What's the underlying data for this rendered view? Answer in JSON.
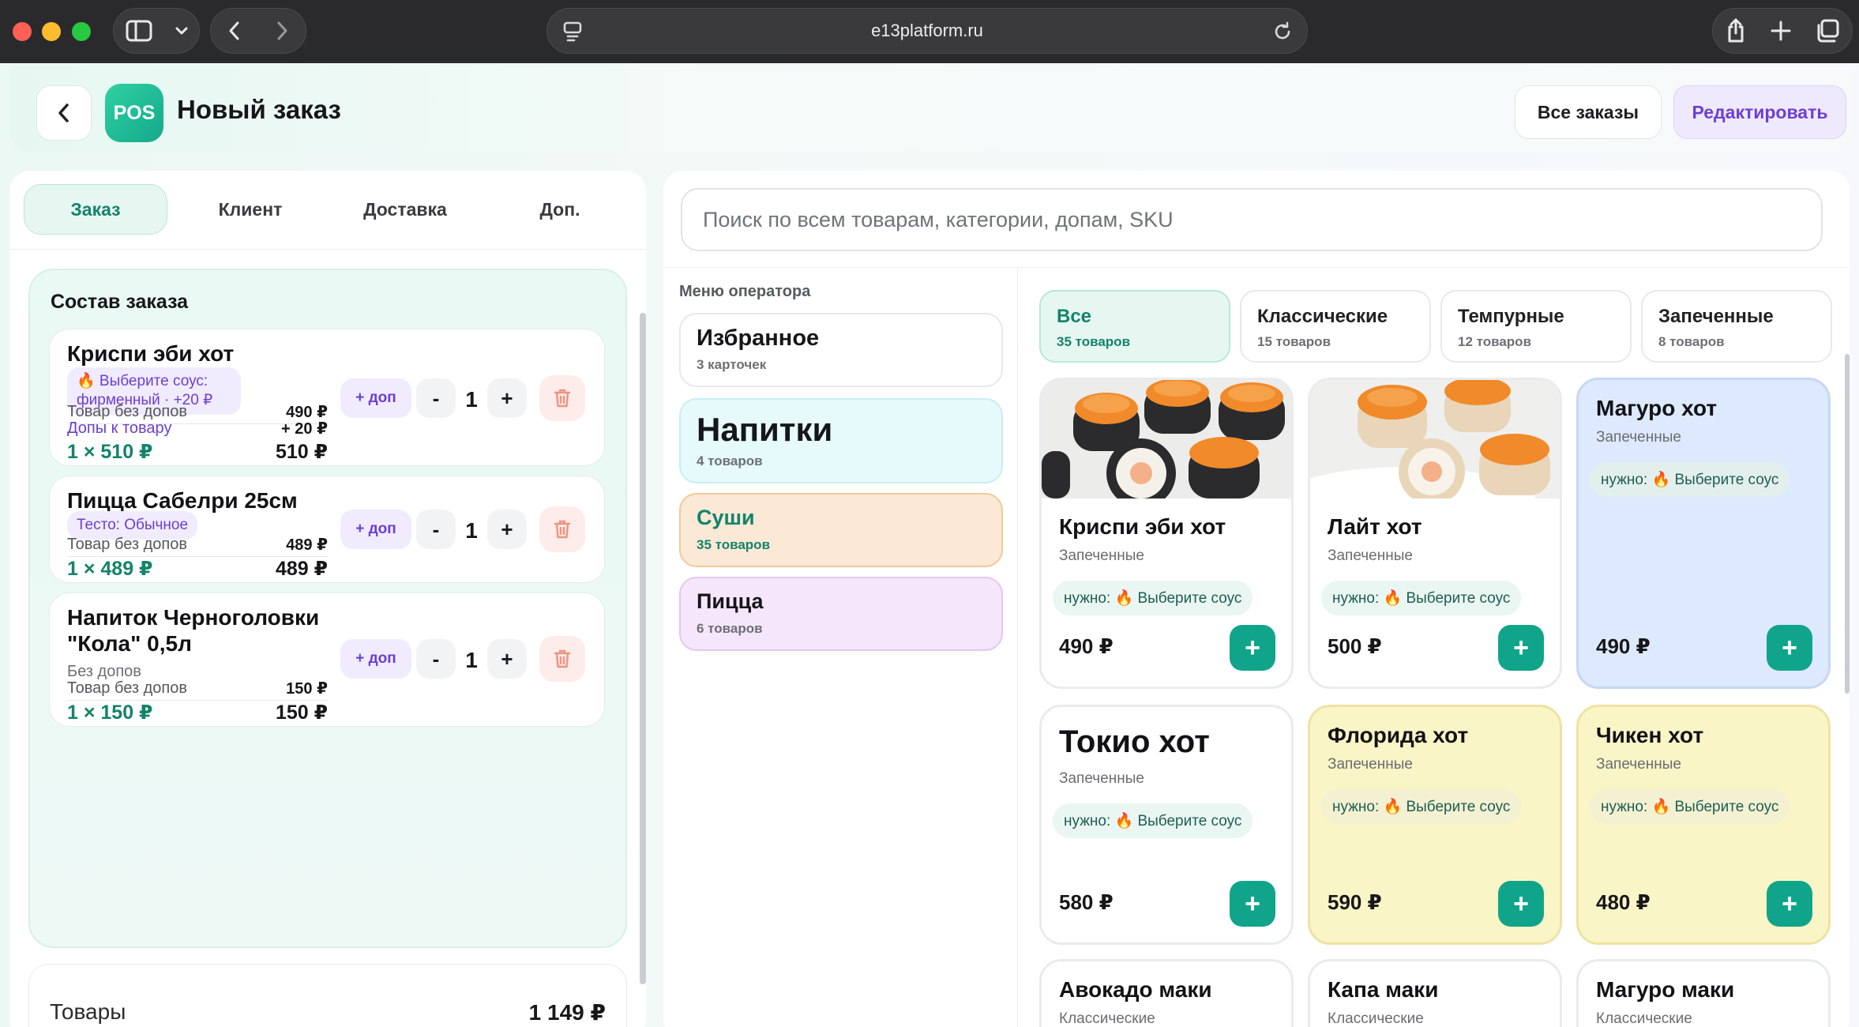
{
  "browser": {
    "url": "e13platform.ru"
  },
  "header": {
    "logo": "POS",
    "title": "Новый заказ",
    "all_orders": "Все заказы",
    "edit": "Редактировать"
  },
  "tabs": [
    "Заказ",
    "Клиент",
    "Доставка",
    "Доп."
  ],
  "order": {
    "title": "Состав заказа",
    "items": [
      {
        "name": "Криспи эби хот",
        "chip": "🔥 Выберите соус: фирменный · +20 ₽",
        "base_label": "Товар без допов",
        "base_price": "490 ₽",
        "addons_label": "Допы к товару",
        "addons_price": "+ 20 ₽",
        "qty_line": "1 × 510 ₽",
        "total": "510 ₽",
        "dop": "+ доп",
        "minus": "-",
        "qty": "1",
        "plus": "+"
      },
      {
        "name": "Пицца Сабелри 25см",
        "chip": "Тесто: Обычное",
        "base_label": "Товар без допов",
        "base_price": "489 ₽",
        "qty_line": "1 × 489 ₽",
        "total": "489 ₽",
        "dop": "+ доп",
        "minus": "-",
        "qty": "1",
        "plus": "+"
      },
      {
        "name": "Напиток Черноголовки \"Кола\" 0,5л",
        "note": "Без допов",
        "base_label": "Товар без допов",
        "base_price": "150 ₽",
        "qty_line": "1 × 150 ₽",
        "total": "150 ₽",
        "dop": "+ доп",
        "minus": "-",
        "qty": "1",
        "plus": "+"
      }
    ],
    "summary_label": "Товары",
    "summary_value": "1 149 ₽"
  },
  "search": {
    "placeholder": "Поиск по всем товарам, категории, допам, SKU"
  },
  "operator_menu": {
    "title": "Меню оператора",
    "cards": [
      {
        "title": "Избранное",
        "sub": "3 карточек"
      },
      {
        "title": "Напитки",
        "sub": "4 товаров"
      },
      {
        "title": "Суши",
        "sub": "35 товаров"
      },
      {
        "title": "Пицца",
        "sub": "6 товаров"
      }
    ]
  },
  "categories": [
    {
      "title": "Все",
      "sub": "35 товаров"
    },
    {
      "title": "Классические",
      "sub": "15 товаров"
    },
    {
      "title": "Темпурные",
      "sub": "12 товаров"
    },
    {
      "title": "Запеченные",
      "sub": "8 товаров"
    }
  ],
  "products": [
    {
      "name": "Криспи эби хот",
      "category": "Запеченные",
      "need": "нужно: 🔥 Выберите соус",
      "price": "490 ₽",
      "add": "+"
    },
    {
      "name": "Лайт хот",
      "category": "Запеченные",
      "need": "нужно: 🔥 Выберите соус",
      "price": "500 ₽",
      "add": "+"
    },
    {
      "name": "Магуро хот",
      "category": "Запеченные",
      "need": "нужно: 🔥 Выберите соус",
      "price": "490 ₽",
      "add": "+"
    },
    {
      "name": "Токио хот",
      "category": "Запеченные",
      "need": "нужно: 🔥 Выберите соус",
      "price": "580 ₽",
      "add": "+"
    },
    {
      "name": "Флорида хот",
      "category": "Запеченные",
      "need": "нужно: 🔥 Выберите соус",
      "price": "590 ₽",
      "add": "+"
    },
    {
      "name": "Чикен хот",
      "category": "Запеченные",
      "need": "нужно: 🔥 Выберите соус",
      "price": "480 ₽",
      "add": "+"
    },
    {
      "name": "Авокадо маки",
      "category": "Классические"
    },
    {
      "name": "Капа маки",
      "category": "Классические"
    },
    {
      "name": "Магуро маки",
      "category": "Классические"
    }
  ],
  "colors": {
    "accent": "#10a58a",
    "purple": "#6b3fd4",
    "card_blue": "#dde9fc",
    "card_yellow": "#faf5c6"
  }
}
